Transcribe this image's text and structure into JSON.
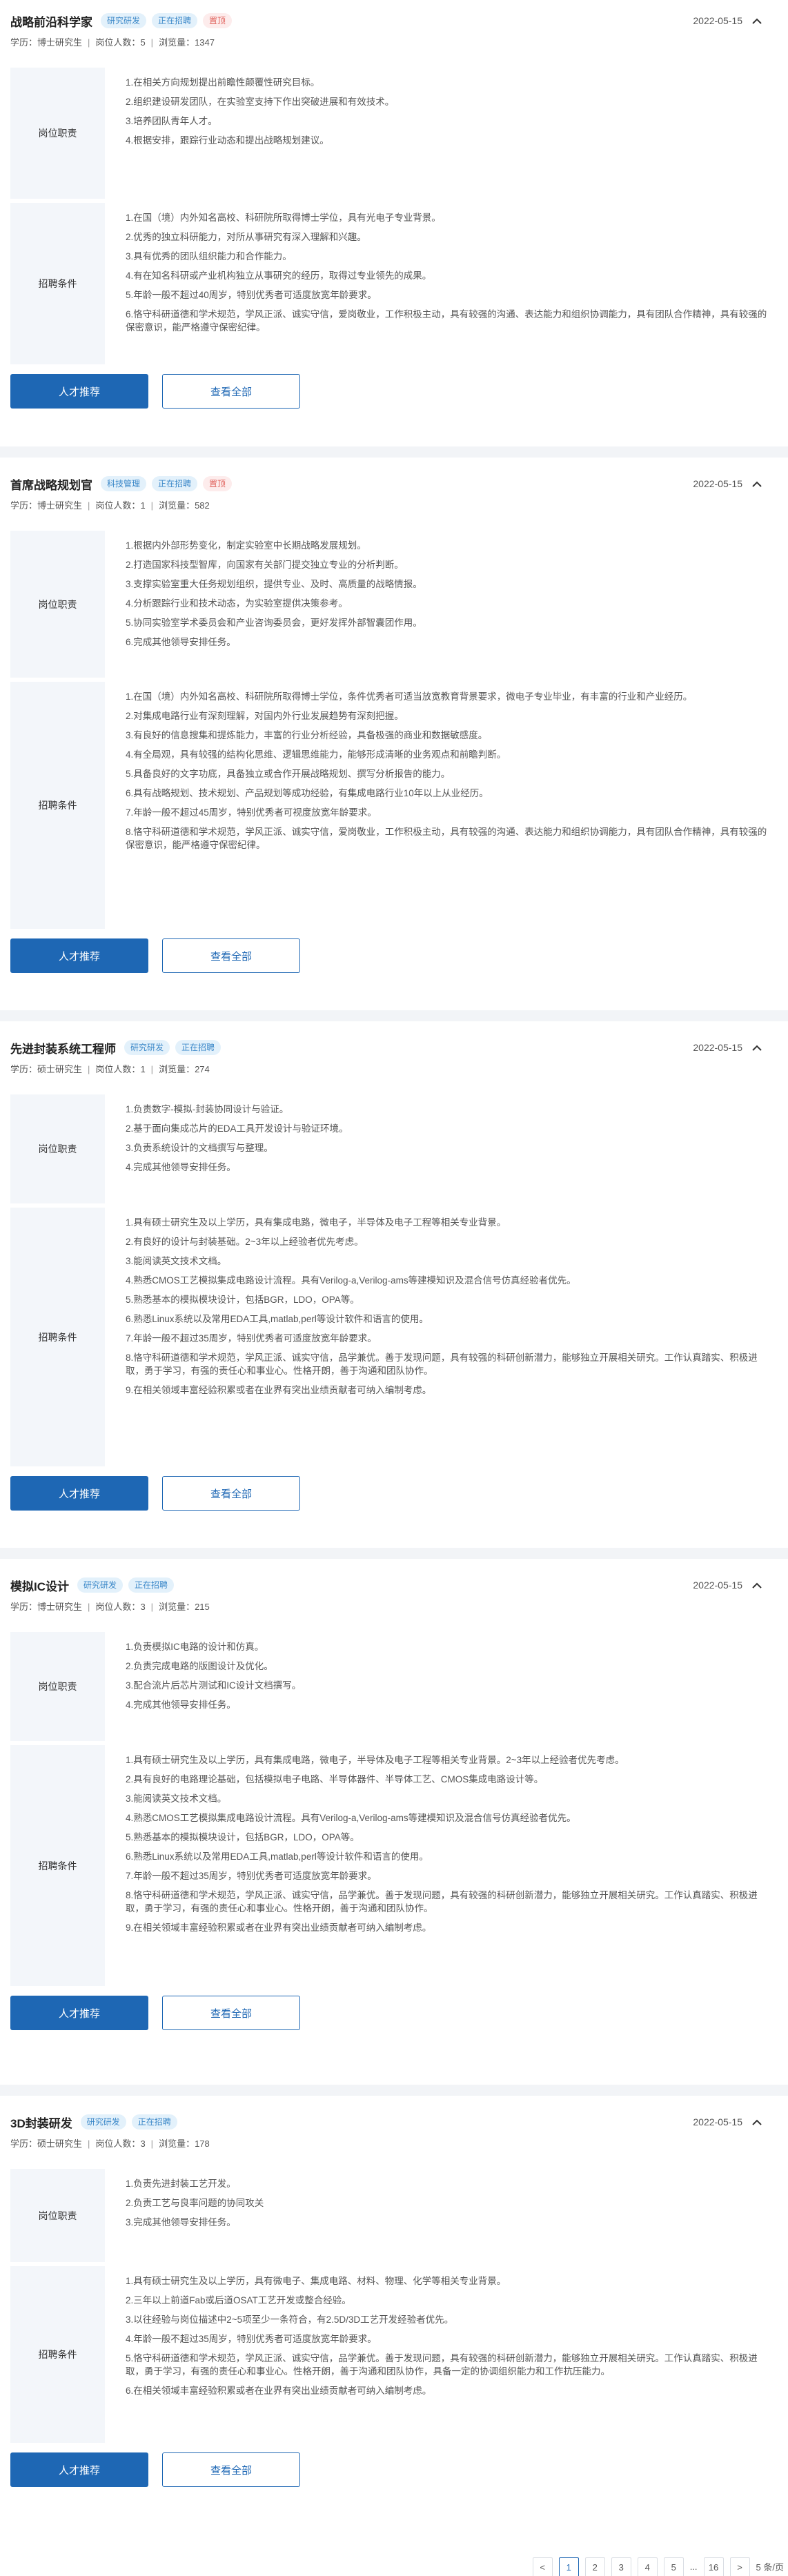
{
  "labels": {
    "duties": "岗位职责",
    "requirements": "招聘条件",
    "recommend": "人才推荐",
    "view_all": "查看全部",
    "edu_prefix": "学历：",
    "count_prefix": "岗位人数：",
    "views_prefix": "浏览量："
  },
  "jobs": [
    {
      "title": "战略前沿科学家",
      "tags": [
        "研究研发",
        "正在招聘",
        "置顶"
      ],
      "date": "2022-05-15",
      "education": "博士研究生",
      "headcount": "5",
      "views": "1347",
      "duties": [
        "1.在相关方向规划提出前瞻性颠覆性研究目标。",
        "2.组织建设研发团队，在实验室支持下作出突破进展和有效技术。",
        "3.培养团队青年人才。",
        "4.根据安排，跟踪行业动态和提出战略规划建议。"
      ],
      "requirements": [
        "1.在国（境）内外知名高校、科研院所取得博士学位，具有光电子专业背景。",
        "2.优秀的独立科研能力，对所从事研究有深入理解和兴趣。",
        "3.具有优秀的团队组织能力和合作能力。",
        "4.有在知名科研或产业机构独立从事研究的经历，取得过专业领先的成果。",
        "5.年龄一般不超过40周岁，特别优秀者可适度放宽年龄要求。",
        "6.恪守科研道德和学术规范，学风正派、诚实守信，爱岗敬业，工作积极主动，具有较强的沟通、表达能力和组织协调能力，具有团队合作精神，具有较强的保密意识，能严格遵守保密纪律。"
      ]
    },
    {
      "title": "首席战略规划官",
      "tags": [
        "科技管理",
        "正在招聘",
        "置顶"
      ],
      "date": "2022-05-15",
      "education": "博士研究生",
      "headcount": "1",
      "views": "582",
      "duties": [
        "1.根据内外部形势变化，制定实验室中长期战略发展规划。",
        "2.打造国家科技型智库，向国家有关部门提交独立专业的分析判断。",
        "3.支撑实验室重大任务规划组织，提供专业、及时、高质量的战略情报。",
        "4.分析跟踪行业和技术动态，为实验室提供决策参考。",
        "5.协同实验室学术委员会和产业咨询委员会，更好发挥外部智囊团作用。",
        "6.完成其他领导安排任务。"
      ],
      "requirements": [
        "1.在国（境）内外知名高校、科研院所取得博士学位，条件优秀者可适当放宽教育背景要求，微电子专业毕业，有丰富的行业和产业经历。",
        "2.对集成电路行业有深刻理解，对国内外行业发展趋势有深刻把握。",
        "3.有良好的信息搜集和提炼能力，丰富的行业分析经验，具备极强的商业和数据敏感度。",
        "4.有全局观，具有较强的结构化思维、逻辑思维能力，能够形成清晰的业务观点和前瞻判断。",
        "5.具备良好的文字功底，具备独立或合作开展战略规划、撰写分析报告的能力。",
        "6.具有战略规划、技术规划、产品规划等成功经验，有集成电路行业10年以上从业经历。",
        "7.年龄一般不超过45周岁，特别优秀者可视度放宽年龄要求。",
        "8.恪守科研道德和学术规范，学风正派、诚实守信，爱岗敬业，工作积极主动，具有较强的沟通、表达能力和组织协调能力，具有团队合作精神，具有较强的保密意识，能严格遵守保密纪律。"
      ]
    },
    {
      "title": "先进封装系统工程师",
      "tags": [
        "研究研发",
        "正在招聘"
      ],
      "date": "2022-05-15",
      "education": "硕士研究生",
      "headcount": "1",
      "views": "274",
      "duties": [
        "1.负责数字-模拟-封装协同设计与验证。",
        "2.基于面向集成芯片的EDA工具开发设计与验证环境。",
        "3.负责系统设计的文档撰写与整理。",
        "4.完成其他领导安排任务。"
      ],
      "requirements": [
        "1.具有硕士研究生及以上学历，具有集成电路，微电子，半导体及电子工程等相关专业背景。",
        "2.有良好的设计与封装基础。2~3年以上经验者优先考虑。",
        "3.能阅读英文技术文档。",
        "4.熟悉CMOS工艺模拟集成电路设计流程。具有Verilog-a,Verilog-ams等建模知识及混合信号仿真经验者优先。",
        "5.熟悉基本的模拟模块设计，包括BGR，LDO，OPA等。",
        "6.熟悉Linux系统以及常用EDA工具,matlab,perl等设计软件和语言的使用。",
        "7.年龄一般不超过35周岁，特别优秀者可适度放宽年龄要求。",
        "8.恪守科研道德和学术规范，学风正派、诚实守信，品学兼优。善于发现问题，具有较强的科研创新潜力，能够独立开展相关研究。工作认真踏实、积极进取，勇于学习，有强的责任心和事业心。性格开朗，善于沟通和团队协作。",
        "9.在相关领域丰富经验积累或者在业界有突出业绩贡献者可纳入编制考虑。"
      ]
    },
    {
      "title": "模拟IC设计",
      "tags": [
        "研究研发",
        "正在招聘"
      ],
      "date": "2022-05-15",
      "education": "博士研究生",
      "headcount": "3",
      "views": "215",
      "duties": [
        "1.负责模拟IC电路的设计和仿真。",
        "2.负责完成电路的版图设计及优化。",
        "3.配合流片后芯片测试和IC设计文档撰写。",
        "4.完成其他领导安排任务。"
      ],
      "requirements": [
        "1.具有硕士研究生及以上学历，具有集成电路，微电子，半导体及电子工程等相关专业背景。2~3年以上经验者优先考虑。",
        "2.具有良好的电路理论基础，包括模拟电子电路、半导体器件、半导体工艺、CMOS集成电路设计等。",
        "3.能阅读英文技术文档。",
        "4.熟悉CMOS工艺模拟集成电路设计流程。具有Verilog-a,Verilog-ams等建模知识及混合信号仿真经验者优先。",
        "5.熟悉基本的模拟模块设计，包括BGR，LDO，OPA等。",
        "6.熟悉Linux系统以及常用EDA工具,matlab,perl等设计软件和语言的使用。",
        "7.年龄一般不超过35周岁，特别优秀者可适度放宽年龄要求。",
        "8.恪守科研道德和学术规范，学风正派、诚实守信，品学兼优。善于发现问题，具有较强的科研创新潜力，能够独立开展相关研究。工作认真踏实、积极进取，勇于学习，有强的责任心和事业心。性格开朗，善于沟通和团队协作。",
        "9.在相关领域丰富经验积累或者在业界有突出业绩贡献者可纳入编制考虑。"
      ]
    },
    {
      "title": "3D封装研发",
      "tags": [
        "研究研发",
        "正在招聘"
      ],
      "date": "2022-05-15",
      "education": "硕士研究生",
      "headcount": "3",
      "views": "178",
      "duties": [
        "1.负责先进封装工艺开发。",
        "2.负责工艺与良率问题的协同攻关",
        "3.完成其他领导安排任务。"
      ],
      "requirements": [
        "1.具有硕士研究生及以上学历，具有微电子、集成电路、材料、物理、化学等相关专业背景。",
        "2.三年以上前道Fab或后道OSAT工艺开发或整合经验。",
        "3.以往经验与岗位描述中2~5项至少一条符合，有2.5D/3D工艺开发经验者优先。",
        "4.年龄一般不超过35周岁，特别优秀者可适度放宽年龄要求。",
        "5.恪守科研道德和学术规范，学风正派、诚实守信，品学兼优。善于发现问题，具有较强的科研创新潜力，能够独立开展相关研究。工作认真踏实、积极进取，勇于学习，有强的责任心和事业心。性格开朗，善于沟通和团队协作，具备一定的协调组织能力和工作抗压能力。",
        "6.在相关领域丰富经验积累或者在业界有突出业绩贡献者可纳入编制考虑。"
      ]
    }
  ],
  "pagination": {
    "pages": [
      "1",
      "2",
      "3",
      "4",
      "5"
    ],
    "ellipsis": "...",
    "last": "16",
    "next": ">",
    "prev": "<",
    "total": "5 条/页",
    "active": "1"
  },
  "colors": {
    "primary": "#1e67b4",
    "tag_blue_bg": "#e3f1fb",
    "tag_red_bg": "#fdecec",
    "section_bg": "#f3f6fa",
    "divider": "#f2f4f7"
  }
}
